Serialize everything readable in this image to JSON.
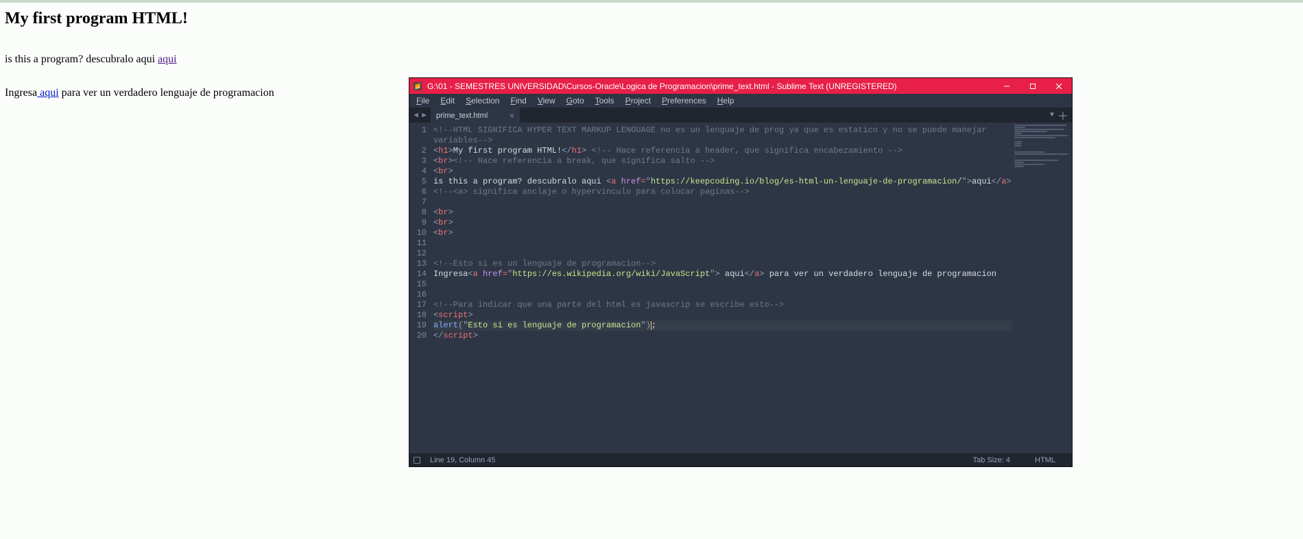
{
  "page": {
    "heading": "My first program HTML!",
    "p1_before": "is this a program? descubralo aqui ",
    "p1_link": "aqui",
    "p2_before": "Ingresa",
    "p2_link": " aqui",
    "p2_after": " para ver un verdadero lenguaje de programacion"
  },
  "sublime": {
    "title": "G:\\01 - SEMESTRES UNIVERSIDAD\\Cursos-Oracle\\Logica de Programacion\\prime_text.html - Sublime Text (UNREGISTERED)",
    "menus": [
      "File",
      "Edit",
      "Selection",
      "Find",
      "View",
      "Goto",
      "Tools",
      "Project",
      "Preferences",
      "Help"
    ],
    "tab_name": "prime_text.html",
    "status_left": "Line 19, Column 45",
    "status_tab": "Tab Size: 4",
    "status_lang": "HTML",
    "lines": [
      {
        "n": "1",
        "segs": [
          [
            "cmt",
            "<!--HTML SIGNIFICA HYPER TEXT MARKUP LENGUAGE no es un lenguaje de prog ya que es estatico y no se puede manejar "
          ]
        ]
      },
      {
        "n": "",
        "segs": [
          [
            "cmt",
            "variables-->"
          ]
        ]
      },
      {
        "n": "2",
        "segs": [
          [
            "angle",
            "<"
          ],
          [
            "tag",
            "h1"
          ],
          [
            "angle",
            ">"
          ],
          [
            "txt",
            "My first program HTML!"
          ],
          [
            "angle",
            "</"
          ],
          [
            "tag",
            "h1"
          ],
          [
            "angle",
            ">"
          ],
          [
            "txt",
            " "
          ],
          [
            "cmt",
            "<!-- Hace referencia a header, que significa encabezamiento -->"
          ]
        ]
      },
      {
        "n": "3",
        "segs": [
          [
            "angle",
            "<"
          ],
          [
            "tag",
            "br"
          ],
          [
            "angle",
            ">"
          ],
          [
            "cmt",
            "<!-- Hace referencia a break, que significa salto -->"
          ]
        ]
      },
      {
        "n": "4",
        "segs": [
          [
            "angle",
            "<"
          ],
          [
            "tag",
            "br"
          ],
          [
            "angle",
            ">"
          ]
        ]
      },
      {
        "n": "5",
        "segs": [
          [
            "txt",
            "is this a program? descubralo aqui "
          ],
          [
            "angle",
            "<"
          ],
          [
            "tag",
            "a"
          ],
          [
            "txt",
            " "
          ],
          [
            "attr",
            "href"
          ],
          [
            "eq",
            "="
          ],
          [
            "punc",
            "\""
          ],
          [
            "str",
            "https://keepcoding.io/blog/es-html-un-lenguaje-de-programacion/"
          ],
          [
            "punc",
            "\""
          ],
          [
            "angle",
            ">"
          ],
          [
            "txt",
            "aqui"
          ],
          [
            "angle",
            "</"
          ],
          [
            "tag",
            "a"
          ],
          [
            "angle",
            ">"
          ]
        ]
      },
      {
        "n": "6",
        "segs": [
          [
            "cmt",
            "<!--<a> significa anclaje o hypervinculo para colocar paginas-->"
          ]
        ]
      },
      {
        "n": "7",
        "segs": []
      },
      {
        "n": "8",
        "segs": [
          [
            "angle",
            "<"
          ],
          [
            "tag",
            "br"
          ],
          [
            "angle",
            ">"
          ]
        ]
      },
      {
        "n": "9",
        "segs": [
          [
            "angle",
            "<"
          ],
          [
            "tag",
            "br"
          ],
          [
            "angle",
            ">"
          ]
        ]
      },
      {
        "n": "10",
        "segs": [
          [
            "angle",
            "<"
          ],
          [
            "tag",
            "br"
          ],
          [
            "angle",
            ">"
          ]
        ]
      },
      {
        "n": "11",
        "segs": []
      },
      {
        "n": "12",
        "segs": []
      },
      {
        "n": "13",
        "segs": [
          [
            "cmt",
            "<!--Esto si es un lenguaje de programacion-->"
          ]
        ]
      },
      {
        "n": "14",
        "segs": [
          [
            "txt",
            "Ingresa"
          ],
          [
            "angle",
            "<"
          ],
          [
            "tag",
            "a"
          ],
          [
            "txt",
            " "
          ],
          [
            "attr",
            "href"
          ],
          [
            "eq",
            "="
          ],
          [
            "punc",
            "\""
          ],
          [
            "str",
            "https://es.wikipedia.org/wiki/JavaScript"
          ],
          [
            "punc",
            "\""
          ],
          [
            "angle",
            ">"
          ],
          [
            "txt",
            " aqui"
          ],
          [
            "angle",
            "</"
          ],
          [
            "tag",
            "a"
          ],
          [
            "angle",
            ">"
          ],
          [
            "txt",
            " para ver un verdadero lenguaje de programacion"
          ]
        ]
      },
      {
        "n": "15",
        "segs": []
      },
      {
        "n": "16",
        "segs": []
      },
      {
        "n": "17",
        "segs": [
          [
            "cmt",
            "<!--Para indicar que una parte del html es javascrip se escribe esto-->"
          ]
        ]
      },
      {
        "n": "18",
        "segs": [
          [
            "angle",
            "<"
          ],
          [
            "tag",
            "script"
          ],
          [
            "angle",
            ">"
          ]
        ]
      },
      {
        "n": "19",
        "hl": true,
        "caret": true,
        "segs": [
          [
            "fn",
            "alert"
          ],
          [
            "punc",
            "("
          ],
          [
            "punc",
            "\""
          ],
          [
            "str",
            "Esto si es lenguaje de programacion"
          ],
          [
            "punc",
            "\""
          ],
          [
            "punc",
            ")"
          ],
          [
            "txt",
            ";"
          ]
        ]
      },
      {
        "n": "20",
        "segs": [
          [
            "angle",
            "</"
          ],
          [
            "tag",
            "script"
          ],
          [
            "angle",
            ">"
          ]
        ]
      }
    ],
    "minimap_widths": [
      95,
      20,
      90,
      60,
      14,
      98,
      75,
      2,
      14,
      14,
      14,
      2,
      2,
      55,
      99,
      2,
      2,
      80,
      18,
      55,
      18
    ]
  }
}
